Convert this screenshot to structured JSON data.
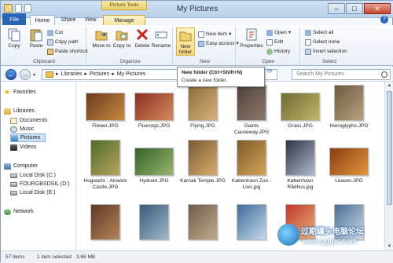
{
  "window": {
    "title": "My Pictures",
    "context_tab_group": "Picture Tools",
    "minimize": "–",
    "maximize": "□",
    "close": "✕"
  },
  "tabs": {
    "file": "File",
    "home": "Home",
    "share": "Share",
    "view": "View",
    "manage": "Manage"
  },
  "ribbon": {
    "clipboard": {
      "label": "Clipboard",
      "copy": "Copy",
      "paste": "Paste",
      "cut": "Cut",
      "copy_path": "Copy path",
      "paste_shortcut": "Paste shortcut"
    },
    "organize": {
      "label": "Organize",
      "move_to": "Move to",
      "copy_to": "Copy to",
      "delete": "Delete",
      "rename": "Rename"
    },
    "new": {
      "label": "New",
      "new_folder": "New folder",
      "new_item": "New item",
      "easy_access": "Easy access"
    },
    "open": {
      "label": "Open",
      "properties": "Properties",
      "open": "Open",
      "edit": "Edit",
      "history": "History"
    },
    "select": {
      "label": "Select",
      "select_all": "Select all",
      "select_none": "Select none",
      "invert_selection": "Invert selection"
    }
  },
  "tooltip": {
    "title": "New folder (Ctrl+Shift+N)",
    "description": "Create a new folder."
  },
  "address": {
    "parts": [
      "Libraries",
      "Pictures",
      "My Pictures"
    ],
    "search_placeholder": "Search My Pictures"
  },
  "nav": {
    "favorites": "Favorites",
    "libraries": "Libraries",
    "documents": "Documents",
    "music": "Music",
    "pictures": "Pictures",
    "videos": "Videos",
    "computer": "Computer",
    "disk_c": "Local Disk (C:)",
    "disk_d": "FOURGBSDSIL (D:)",
    "disk_e": "Local Disk (E:)",
    "network": "Network"
  },
  "files": [
    {
      "name": "Flower.JPG",
      "colors": [
        "#6b3a1f",
        "#c98a3c"
      ]
    },
    {
      "name": "Fluevogs.JPG",
      "colors": [
        "#8e2e21",
        "#d28b5c"
      ]
    },
    {
      "name": "Flying.JPG",
      "colors": [
        "#8a6b3b",
        "#d9b27a"
      ]
    },
    {
      "name": "Giants Causeway.JPG",
      "colors": [
        "#4e4039",
        "#8d7a6b"
      ]
    },
    {
      "name": "Grass.JPG",
      "colors": [
        "#6e6a33",
        "#c3b569"
      ]
    },
    {
      "name": "Hieroglyphs.JPG",
      "colors": [
        "#6c5a40",
        "#b8a27e"
      ]
    },
    {
      "name": "Hogwarts - Alnwick Castle.JPG",
      "colors": [
        "#4f6b2c",
        "#b6a35a"
      ]
    },
    {
      "name": "Hydrant.JPG",
      "colors": [
        "#34602a",
        "#96b76a"
      ]
    },
    {
      "name": "Karnak Temple.JPG",
      "colors": [
        "#7a5a34",
        "#d8ad6c"
      ]
    },
    {
      "name": "København Zoo - Lion.jpg",
      "colors": [
        "#7c5a29",
        "#d6a35a"
      ]
    },
    {
      "name": "København Rådhus.jpg",
      "colors": [
        "#2e3440",
        "#aebad0"
      ]
    },
    {
      "name": "Leaves.JPG",
      "colors": [
        "#8a3c12",
        "#e3963a"
      ]
    },
    {
      "name": "",
      "colors": [
        "#5c3a24",
        "#b7835a"
      ]
    },
    {
      "name": "",
      "colors": [
        "#3a5a7a",
        "#9fb8c9"
      ]
    },
    {
      "name": "",
      "colors": [
        "#6f5d48",
        "#c1ab8b"
      ]
    },
    {
      "name": "",
      "colors": [
        "#3d6c9b",
        "#c4d8e8"
      ]
    },
    {
      "name": "",
      "colors": [
        "#c0372b",
        "#e8b47a"
      ]
    },
    {
      "name": "",
      "colors": [
        "#4a6e94",
        "#cfdbe6"
      ]
    }
  ],
  "status": {
    "count": "57 items",
    "selected": "1 item selected",
    "size": "3.68 MB"
  },
  "watermark": {
    "line1": "过期罐头电脑论坛",
    "line2": "www.ggtpc.com"
  }
}
